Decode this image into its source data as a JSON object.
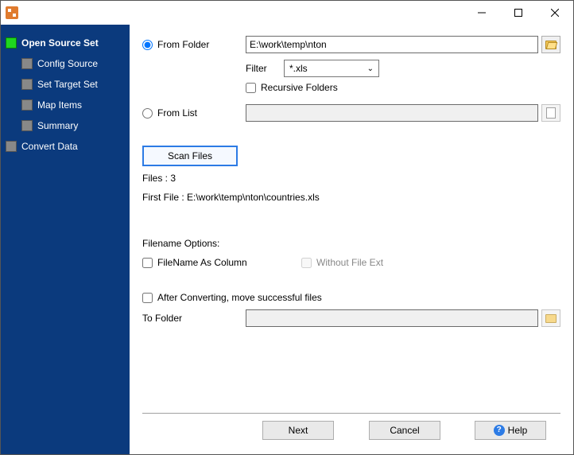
{
  "sidebar": {
    "items": [
      {
        "label": "Open Source Set",
        "active": true
      },
      {
        "label": "Config Source"
      },
      {
        "label": "Set Target Set"
      },
      {
        "label": "Map Items"
      },
      {
        "label": "Summary"
      },
      {
        "label": "Convert Data"
      }
    ]
  },
  "source": {
    "from_folder_label": "From Folder",
    "folder_path": "E:\\work\\temp\\nton",
    "filter_label": "Filter",
    "filter_value": "*.xls",
    "recursive_label": "Recursive Folders",
    "from_list_label": "From List",
    "list_path": "",
    "scan_button": "Scan Files",
    "files_count": "Files : 3",
    "first_file": "First File : E:\\work\\temp\\nton\\countries.xls"
  },
  "filename_opts": {
    "heading": "Filename Options:",
    "filename_as_column_label": "FileName As Column",
    "without_ext_label": "Without File Ext"
  },
  "after": {
    "move_label": "After Converting, move successful files",
    "to_folder_label": "To Folder",
    "to_folder_path": ""
  },
  "footer": {
    "next": "Next",
    "cancel": "Cancel",
    "help": "Help"
  }
}
